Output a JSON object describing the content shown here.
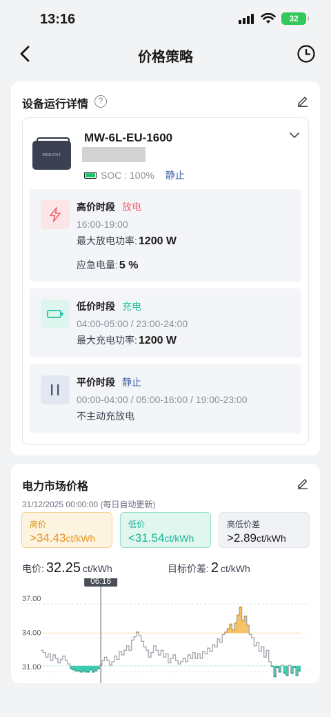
{
  "status_bar": {
    "time": "13:16",
    "battery": "32"
  },
  "nav": {
    "title": "价格策略"
  },
  "device_card": {
    "title": "设备运行详情",
    "device": {
      "model": "MW-6L-EU-1600",
      "image_text": "INDEVOLT",
      "soc_label": "SOC : 100%",
      "state": "静止"
    },
    "periods": [
      {
        "type": "high",
        "title": "高价时段",
        "mode": "放电",
        "time": "16:00-19:00",
        "lines": [
          {
            "label": "最大放电功率:",
            "value": "1200 W"
          },
          {
            "label": "应急电量:",
            "value": "5 %"
          }
        ]
      },
      {
        "type": "low",
        "title": "低价时段",
        "mode": "充电",
        "time": "04:00-05:00 / 23:00-24:00",
        "lines": [
          {
            "label": "最大充电功率:",
            "value": "1200 W"
          }
        ]
      },
      {
        "type": "flat",
        "title": "平价时段",
        "mode": "静止",
        "time": "00:00-04:00 / 05:00-16:00 / 19:00-23:00",
        "lines": [
          {
            "label": "不主动充放电",
            "value": ""
          }
        ]
      }
    ]
  },
  "market_card": {
    "title": "电力市场价格",
    "updated": "31/12/2025 00:00:00 (每日自动更新)",
    "boxes": {
      "high": {
        "label": "高价",
        "value": ">34.43",
        "unit": "ct/kWh"
      },
      "low": {
        "label": "低价",
        "value": "<31.54",
        "unit": "ct/kWh"
      },
      "diff": {
        "label": "高低价差",
        "value": ">2.89",
        "unit": "ct/kWh"
      }
    },
    "current_price": {
      "label": "电价:",
      "value": "32.25",
      "unit": "ct/kWh"
    },
    "target_spread": {
      "label": "目标价差:",
      "value": "2",
      "unit": "ct/kWh"
    }
  },
  "colors": {
    "high": "#f5b745",
    "low": "#1bc1a1",
    "flat": "#8a8f99",
    "accent_blue": "#3e63a8",
    "discharge_red": "#f0616d"
  },
  "chart_data": {
    "type": "line",
    "title": "",
    "xlabel": "",
    "ylabel": "",
    "y_ticks": [
      "37.00",
      "34.00",
      "31.00"
    ],
    "ylim": [
      30.5,
      37.6
    ],
    "high_threshold": 34.43,
    "low_threshold": 31.54,
    "cursor_label": "06:16",
    "cursor_index": 24,
    "values": [
      32.9,
      32.7,
      32.3,
      32.6,
      32.0,
      32.5,
      32.2,
      31.8,
      32.1,
      32.4,
      32.0,
      31.7,
      31.3,
      31.2,
      31.1,
      31.1,
      31.0,
      31.1,
      31.0,
      31.0,
      31.2,
      31.0,
      31.1,
      31.3,
      31.6,
      32.0,
      32.3,
      32.0,
      31.6,
      31.9,
      32.4,
      32.1,
      32.8,
      32.5,
      32.9,
      33.3,
      32.9,
      33.8,
      34.1,
      34.5,
      34.2,
      33.7,
      33.2,
      32.9,
      32.3,
      32.7,
      33.3,
      32.9,
      32.5,
      32.9,
      32.3,
      32.6,
      31.8,
      32.2,
      32.5,
      32.0,
      31.7,
      31.9,
      32.2,
      31.9,
      32.5,
      32.2,
      32.7,
      32.2,
      32.6,
      32.2,
      32.8,
      32.6,
      33.1,
      32.8,
      33.4,
      33.2,
      33.9,
      33.6,
      34.3,
      34.5,
      34.8,
      35.2,
      34.7,
      35.3,
      36.0,
      36.7,
      35.5,
      35.9,
      35.1,
      34.3,
      34.0,
      33.3,
      33.6,
      32.8,
      33.2,
      32.3,
      32.9,
      31.9,
      31.5,
      30.6,
      31.4,
      31.0,
      31.6,
      30.9,
      30.7,
      31.6,
      30.9,
      31.4,
      30.7,
      31.1
    ]
  }
}
